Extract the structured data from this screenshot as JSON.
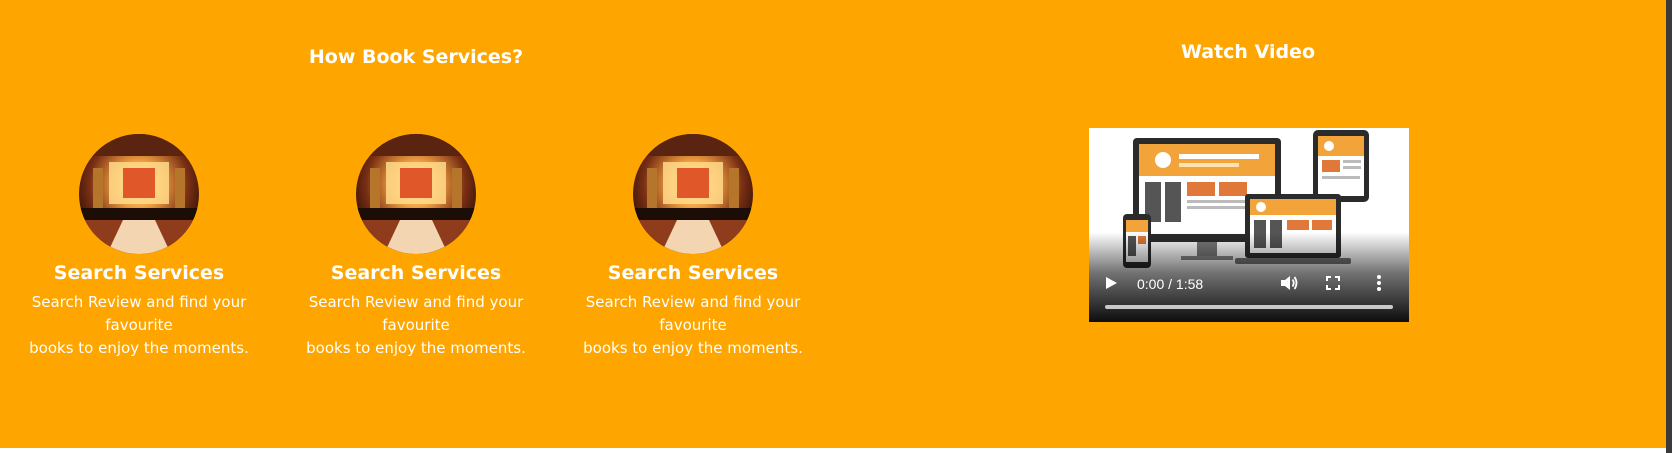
{
  "section": {
    "background": "#FFA500",
    "how_title": "How Book Services?",
    "video_title": "Watch Video"
  },
  "steps": [
    {
      "title": "Search Services",
      "desc_line1": "Search Review and find your favourite",
      "desc_line2": "books to enjoy the moments.",
      "image": "wedding-hall-thumbnail"
    },
    {
      "title": "Search Services",
      "desc_line1": "Search Review and find your favourite",
      "desc_line2": "books to enjoy the moments.",
      "image": "wedding-hall-thumbnail"
    },
    {
      "title": "Search Services",
      "desc_line1": "Search Review and find your favourite",
      "desc_line2": "books to enjoy the moments.",
      "image": "wedding-hall-thumbnail"
    }
  ],
  "video": {
    "time_display": "0:00 / 1:58",
    "progress": 0,
    "poster": "responsive-devices-illustration",
    "icons": [
      "play-icon",
      "volume-icon",
      "fullscreen-icon",
      "more-options-icon"
    ]
  }
}
